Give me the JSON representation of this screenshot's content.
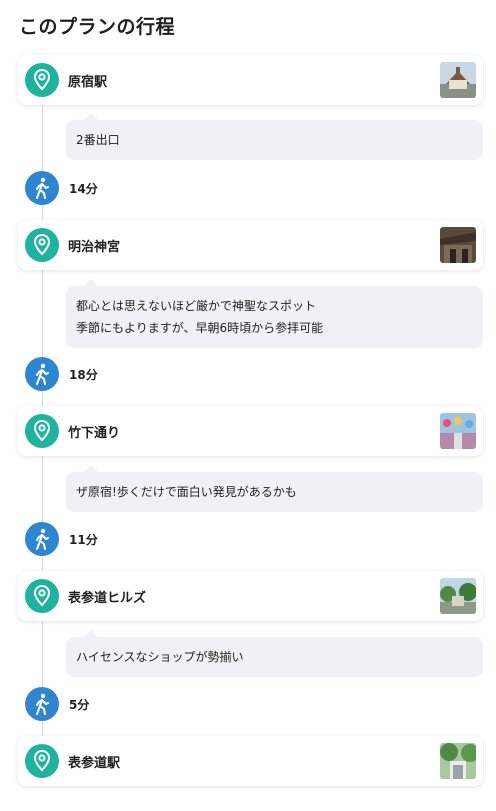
{
  "header": {
    "title": "このプランの行程"
  },
  "spots": [
    {
      "name": "原宿駅",
      "icon": "map-pin-icon",
      "thumb": "station-building-photo"
    },
    {
      "name": "明治神宮",
      "icon": "map-pin-icon",
      "thumb": "shrine-photo"
    },
    {
      "name": "竹下通り",
      "icon": "map-pin-icon",
      "thumb": "shopping-street-photo"
    },
    {
      "name": "表参道ヒルズ",
      "icon": "map-pin-icon",
      "thumb": "trees-building-photo"
    },
    {
      "name": "表参道駅",
      "icon": "map-pin-icon",
      "thumb": "station-exit-photo"
    }
  ],
  "notes": [
    {
      "lines": [
        "2番出口"
      ]
    },
    {
      "lines": [
        "都心とは思えないほど厳かで神聖なスポット",
        "季節にもよりますが、早朝6時頃から参拝可能"
      ]
    },
    {
      "lines": [
        "ザ原宿!歩くだけで面白い発見があるかも"
      ]
    },
    {
      "lines": [
        "ハイセンスなショップが勢揃い"
      ]
    }
  ],
  "walks": [
    {
      "time": "14分",
      "icon": "walking-person-icon"
    },
    {
      "time": "18分",
      "icon": "walking-person-icon"
    },
    {
      "time": "11分",
      "icon": "walking-person-icon"
    },
    {
      "time": "5分",
      "icon": "walking-person-icon"
    }
  ],
  "colors": {
    "pin": "#1fb29e",
    "walk": "#2e86d1",
    "note_bg": "#eef2f7"
  }
}
